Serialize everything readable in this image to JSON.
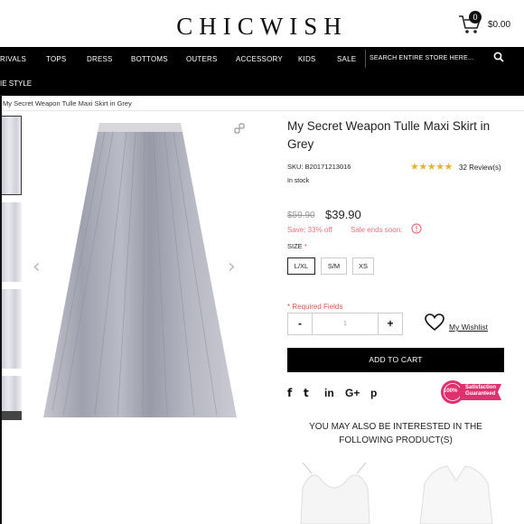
{
  "header": {
    "logo": "CHICWISH",
    "cart_count": "0",
    "cart_total": "$0.00"
  },
  "nav": {
    "items": [
      "RIVALS",
      "TOPS",
      "DRESS",
      "BOTTOMS",
      "OUTERS",
      "ACCESSORY",
      "KIDS",
      "SALE"
    ],
    "row2": "IE STYLE",
    "search_placeholder": "SEARCH ENTIRE STORE HERE..."
  },
  "breadcrumb": "My Secret Weapon Tulle Maxi Skirt in Grey",
  "product": {
    "title": "My Secret Weapon Tulle Maxi Skirt in Grey",
    "sku": "SKU: B20171213016",
    "rating": 4.5,
    "stars": "★★★★★",
    "reviews": "32 Review(s)",
    "stock": "In stock",
    "old_price": "$59.90",
    "new_price": "$39.90",
    "save": "Save: 33% off",
    "sale_ends": "Sale ends soon:",
    "size_label": "SIZE",
    "required_mark": "*",
    "sizes": [
      "L/XL",
      "S/M",
      "XS"
    ],
    "selected_size": "L/XL",
    "required_fields": "* Required Fields",
    "quantity": "1",
    "minus": "-",
    "plus": "+",
    "wishlist": "My Wishlist",
    "add_to_cart": "ADD TO CART"
  },
  "social": [
    "f",
    "t",
    "in",
    "G+",
    "p"
  ],
  "badge": {
    "pct": "100%",
    "line1": "Satisfaction",
    "line2": "Guaranteed"
  },
  "also": "YOU MAY ALSO BE INTERESTED IN THE FOLLOWING PRODUCT(S)",
  "colors": {
    "skirt": "#a9abb8",
    "sale": "#e8727a",
    "star": "#e4b52c",
    "badge": "#e0306e"
  },
  "icons": [
    "cart-icon",
    "search-icon",
    "link-icon",
    "clock-icon",
    "heart-icon",
    "chevron-left-icon",
    "chevron-right-icon",
    "facebook-icon",
    "twitter-icon",
    "linkedin-icon",
    "google-plus-icon",
    "pinterest-icon"
  ]
}
